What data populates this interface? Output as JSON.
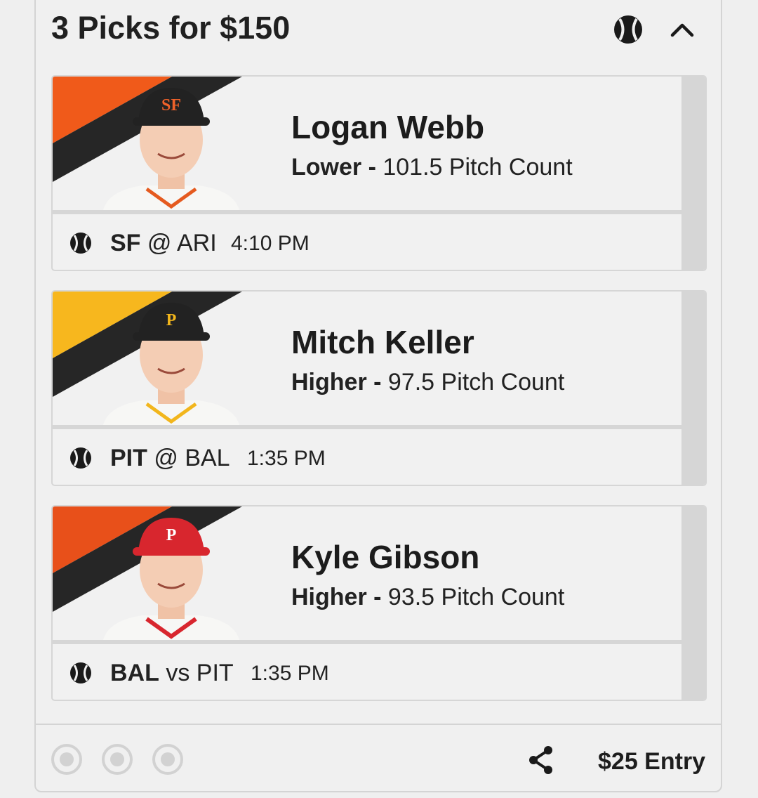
{
  "header": {
    "title": "3 Picks for $150",
    "sport_icon": "baseball-icon",
    "toggle_icon": "chevron-up-icon"
  },
  "picks": [
    {
      "player": "Logan Webb",
      "direction": "Lower",
      "line": "101.5 Pitch Count",
      "team": "SF",
      "separator": "@",
      "opponent": "ARI",
      "time": "4:10 PM",
      "accent_color": "#f05a1a",
      "cap_color": "#222222",
      "logo_text": "SF"
    },
    {
      "player": "Mitch Keller",
      "direction": "Higher",
      "line": "97.5 Pitch Count",
      "team": "PIT",
      "separator": "@",
      "opponent": "BAL",
      "time": "1:35 PM",
      "accent_color": "#f7b71e",
      "cap_color": "#222222",
      "logo_text": "P"
    },
    {
      "player": "Kyle Gibson",
      "direction": "Higher",
      "line": "93.5 Pitch Count",
      "team": "BAL",
      "separator": "vs",
      "opponent": "PIT",
      "time": "1:35 PM",
      "accent_color": "#e8501a",
      "cap_color": "#d8262e",
      "logo_text": "P"
    }
  ],
  "footer": {
    "dot_count": 3,
    "share_icon": "share-icon",
    "entry_label": "$25 Entry"
  },
  "colors": {
    "background": "#efefef",
    "card_border": "#d6d6d6",
    "stripe_dark": "#262626",
    "text": "#222222"
  }
}
